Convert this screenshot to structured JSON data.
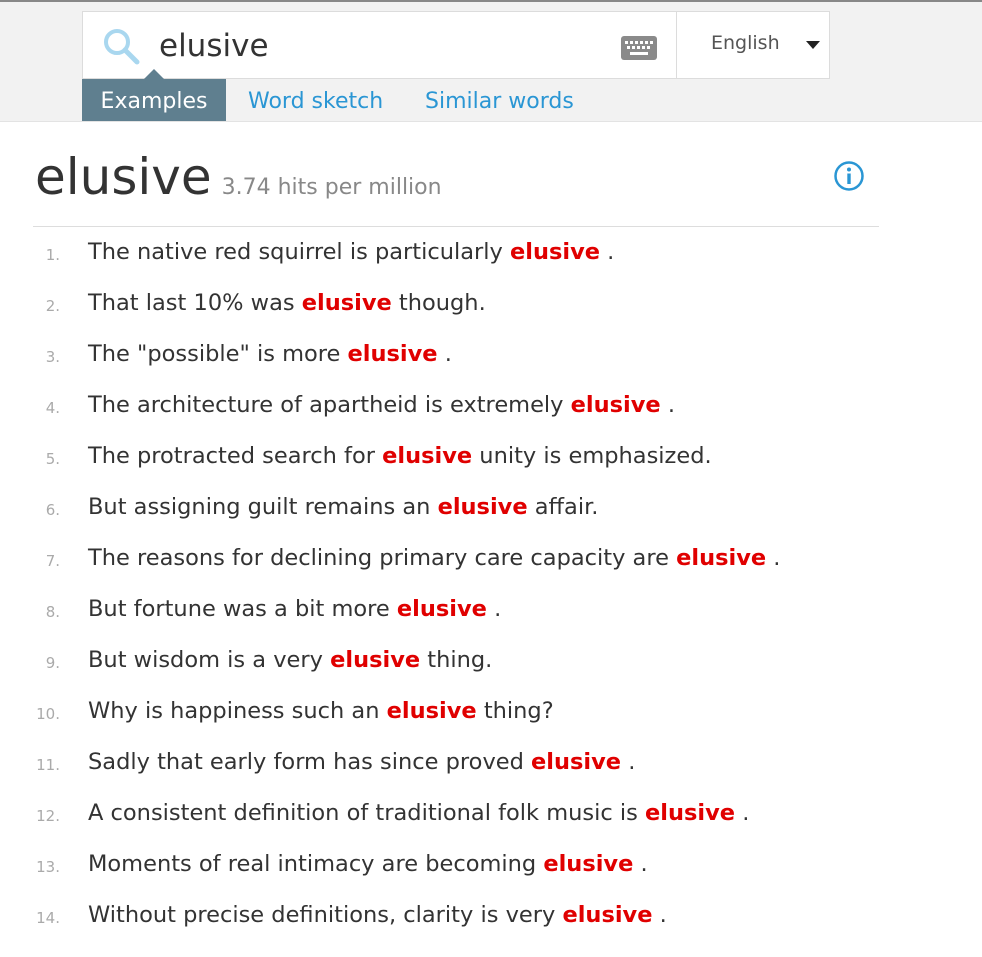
{
  "search": {
    "query": "elusive"
  },
  "language": {
    "selected": "English"
  },
  "tabs": [
    {
      "label": "Examples"
    },
    {
      "label": "Word sketch"
    },
    {
      "label": "Similar words"
    }
  ],
  "result": {
    "word": "elusive",
    "frequency": "3.74 hits per million"
  },
  "examples": [
    {
      "num": "1.",
      "before": "The native red squirrel is particularly ",
      "keyword": "elusive",
      "after": " ."
    },
    {
      "num": "2.",
      "before": "That last 10% was ",
      "keyword": "elusive",
      "after": " though."
    },
    {
      "num": "3.",
      "before": "The \"possible\" is more ",
      "keyword": "elusive",
      "after": " ."
    },
    {
      "num": "4.",
      "before": "The architecture of apartheid is extremely ",
      "keyword": "elusive",
      "after": " ."
    },
    {
      "num": "5.",
      "before": "The protracted search for ",
      "keyword": "elusive",
      "after": " unity is emphasized."
    },
    {
      "num": "6.",
      "before": "But assigning guilt remains an ",
      "keyword": "elusive",
      "after": " affair."
    },
    {
      "num": "7.",
      "before": "The reasons for declining primary care capacity are ",
      "keyword": "elusive",
      "after": " ."
    },
    {
      "num": "8.",
      "before": "But fortune was a bit more ",
      "keyword": "elusive",
      "after": " ."
    },
    {
      "num": "9.",
      "before": "But wisdom is a very ",
      "keyword": "elusive",
      "after": " thing."
    },
    {
      "num": "10.",
      "before": "Why is happiness such an ",
      "keyword": "elusive",
      "after": " thing?"
    },
    {
      "num": "11.",
      "before": "Sadly that early form has since proved ",
      "keyword": "elusive",
      "after": " ."
    },
    {
      "num": "12.",
      "before": "A consistent definition of traditional folk music is ",
      "keyword": "elusive",
      "after": " ."
    },
    {
      "num": "13.",
      "before": "Moments of real intimacy are becoming ",
      "keyword": "elusive",
      "after": " ."
    },
    {
      "num": "14.",
      "before": "Without precise definitions, clarity is very ",
      "keyword": "elusive",
      "after": " ."
    }
  ],
  "icons": {
    "search": "search-icon",
    "keyboard": "keyboard-icon",
    "dropdown": "chevron-down-icon",
    "info": "info-icon"
  },
  "colors": {
    "keyword": "#e00000",
    "link": "#2a96d4",
    "active_tab": "#5f7f8f",
    "header_bg": "#f2f2f2"
  }
}
